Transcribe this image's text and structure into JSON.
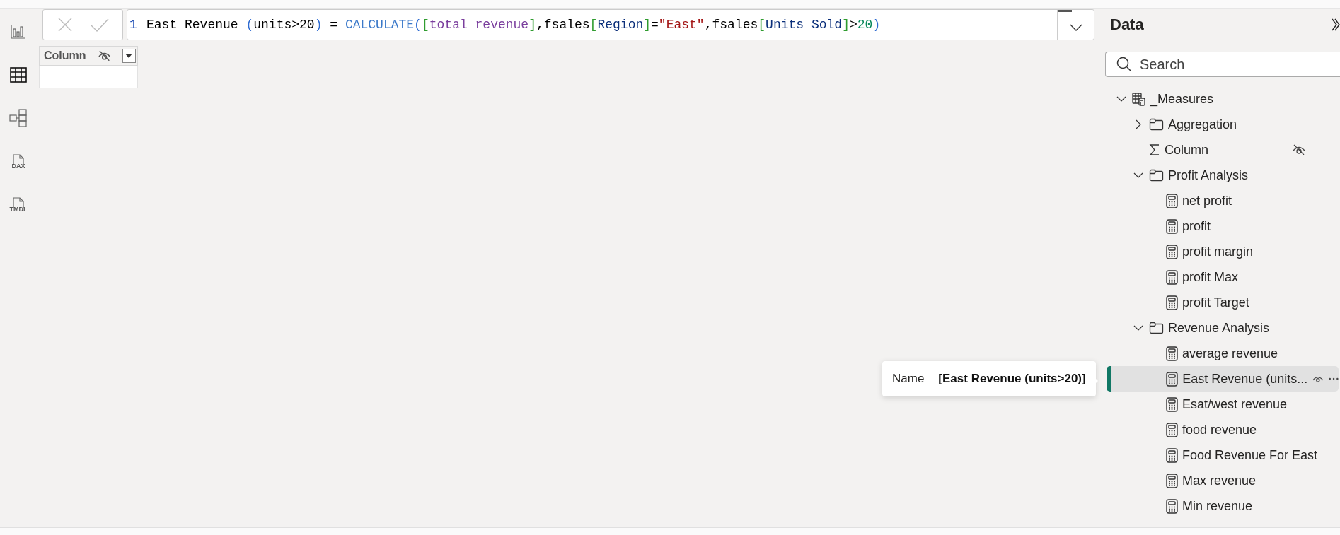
{
  "view_rail": [
    {
      "kind": "report",
      "selected": false
    },
    {
      "kind": "table",
      "selected": true
    },
    {
      "kind": "model",
      "selected": false
    },
    {
      "kind": "dax",
      "label": "DAX",
      "selected": false
    },
    {
      "kind": "tmdl",
      "label": "TMDL",
      "selected": false
    }
  ],
  "formula_bar": {
    "line_number": "1",
    "tokens": [
      {
        "text": "East Revenue ",
        "kind": "plain"
      },
      {
        "text": "(",
        "kind": "paren"
      },
      {
        "text": "units>20",
        "kind": "plain"
      },
      {
        "text": ")",
        "kind": "paren"
      },
      {
        "text": " = ",
        "kind": "plain"
      },
      {
        "text": "CALCULATE",
        "kind": "function"
      },
      {
        "text": "(",
        "kind": "paren"
      },
      {
        "text": "[",
        "kind": "bracket"
      },
      {
        "text": "total revenue",
        "kind": "measure"
      },
      {
        "text": "]",
        "kind": "bracket"
      },
      {
        "text": ",fsales",
        "kind": "plain"
      },
      {
        "text": "[",
        "kind": "bracket"
      },
      {
        "text": "Region",
        "kind": "column"
      },
      {
        "text": "]",
        "kind": "bracket"
      },
      {
        "text": "=",
        "kind": "plain"
      },
      {
        "text": "\"East\"",
        "kind": "string"
      },
      {
        "text": ",fsales",
        "kind": "plain"
      },
      {
        "text": "[",
        "kind": "bracket"
      },
      {
        "text": "Units Sold",
        "kind": "column"
      },
      {
        "text": "]",
        "kind": "bracket"
      },
      {
        "text": ">",
        "kind": "plain"
      },
      {
        "text": "20",
        "kind": "number"
      },
      {
        "text": ")",
        "kind": "paren"
      }
    ]
  },
  "table": {
    "columns": [
      {
        "name": "Column",
        "hidden": true
      }
    ]
  },
  "tooltip": {
    "label": "Name",
    "value": "[East Revenue (units>20)]"
  },
  "data_pane": {
    "title": "Data",
    "search": {
      "placeholder": "Search"
    },
    "tree": [
      {
        "name": "_Measures",
        "kind": "table",
        "expanded": true,
        "selected": false,
        "children": [
          {
            "name": "Aggregation",
            "kind": "folder",
            "expanded": false,
            "selected": false
          },
          {
            "name": "Column",
            "kind": "column",
            "hidden": true,
            "selected": false
          },
          {
            "name": "Profit Analysis",
            "kind": "folder",
            "expanded": true,
            "selected": false,
            "children": [
              {
                "name": "net profit",
                "kind": "measure",
                "selected": false
              },
              {
                "name": "profit",
                "kind": "measure",
                "selected": false
              },
              {
                "name": "profit margin",
                "kind": "measure",
                "selected": false
              },
              {
                "name": "profit Max",
                "kind": "measure",
                "selected": false
              },
              {
                "name": "profit Target",
                "kind": "measure",
                "selected": false
              }
            ]
          },
          {
            "name": "Revenue Analysis",
            "kind": "folder",
            "expanded": true,
            "selected": false,
            "children": [
              {
                "name": "average revenue",
                "kind": "measure",
                "selected": false
              },
              {
                "name": "East Revenue (units...",
                "kind": "measure",
                "selected": true
              },
              {
                "name": "Esat/west revenue",
                "kind": "measure",
                "selected": false
              },
              {
                "name": "food revenue",
                "kind": "measure",
                "selected": false
              },
              {
                "name": "Food Revenue For East",
                "kind": "measure",
                "selected": false
              },
              {
                "name": "Max revenue",
                "kind": "measure",
                "selected": false
              },
              {
                "name": "Min revenue",
                "kind": "measure",
                "selected": false
              }
            ]
          }
        ]
      }
    ]
  }
}
